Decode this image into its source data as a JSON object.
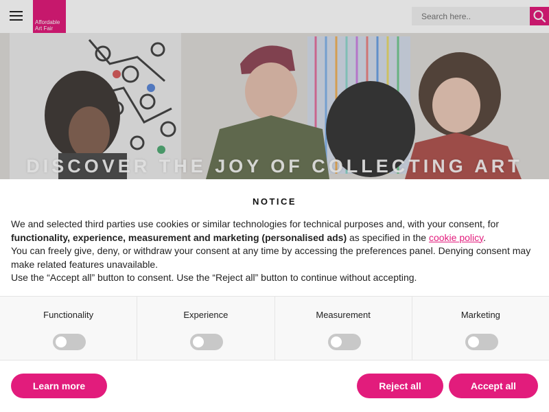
{
  "header": {
    "logo_line1": "Affordable",
    "logo_line2": "Art Fair",
    "search_placeholder": "Search here.."
  },
  "hero": {
    "title": "DISCOVER THE JOY OF COLLECTING ART"
  },
  "notice": {
    "title": "NOTICE",
    "p1_a": "We and selected third parties use cookies or similar technologies for technical purposes and, with your consent, for ",
    "p1_bold": "functionality, experience, measurement and marketing (personalised ads)",
    "p1_b": " as specified in the ",
    "p1_link": "cookie policy",
    "p1_c": ".",
    "p2": "You can freely give, deny, or withdraw your consent at any time by accessing the preferences panel. Denying consent may make related features unavailable.",
    "p3": "Use the “Accept all” button to consent. Use the “Reject all” button to continue without accepting."
  },
  "preferences": [
    {
      "label": "Functionality",
      "enabled": false
    },
    {
      "label": "Experience",
      "enabled": false
    },
    {
      "label": "Measurement",
      "enabled": false
    },
    {
      "label": "Marketing",
      "enabled": false
    }
  ],
  "buttons": {
    "learn_more": "Learn more",
    "reject_all": "Reject all",
    "accept_all": "Accept all"
  },
  "colors": {
    "brand": "#e21c7c"
  },
  "icons": [
    "menu-icon",
    "search-icon"
  ]
}
